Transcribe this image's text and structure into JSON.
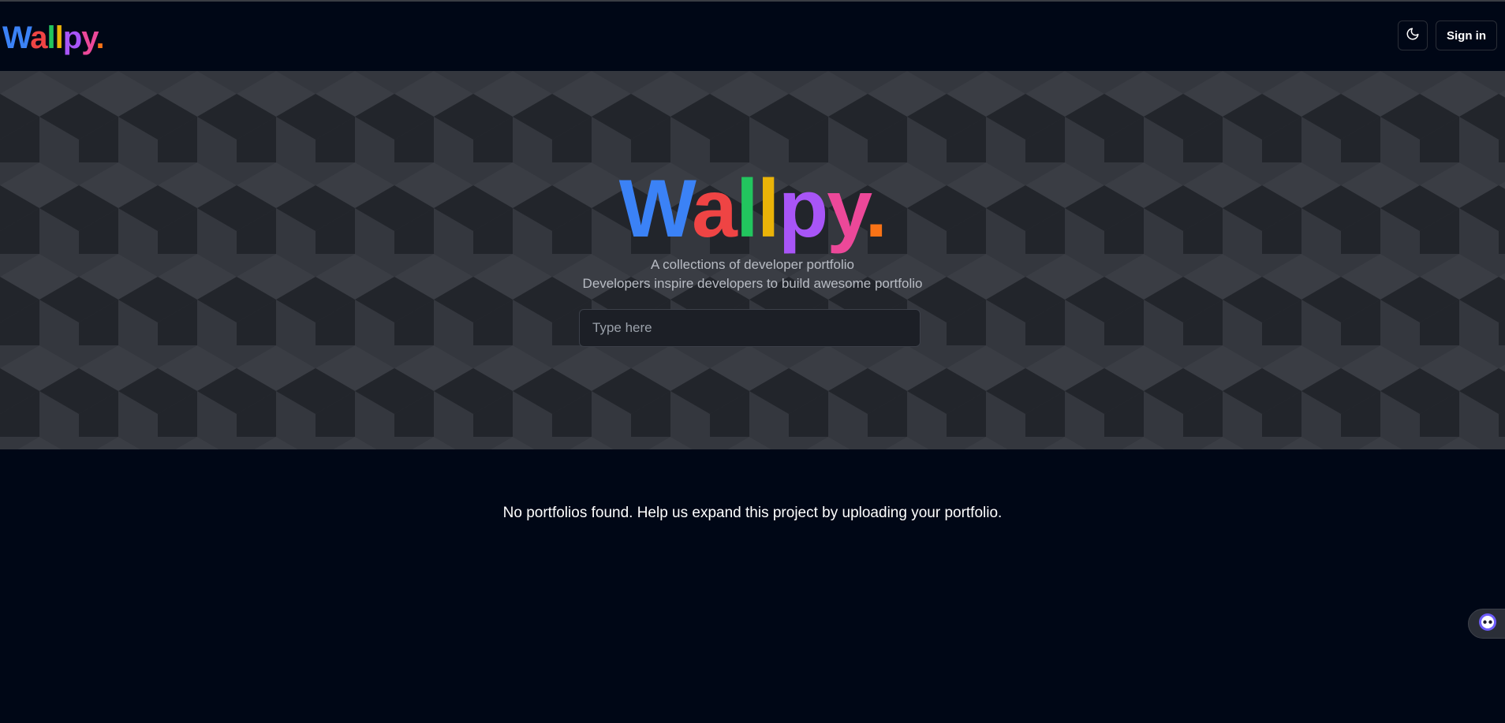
{
  "brand": {
    "letters": [
      "W",
      "a",
      "l",
      "l",
      "p",
      "y",
      "."
    ],
    "colors": [
      "#3b82f6",
      "#ef4444",
      "#22c55e",
      "#eab308",
      "#a855f7",
      "#ec4899",
      "#f97316"
    ]
  },
  "header": {
    "theme_icon": "moon-icon",
    "sign_in_label": "Sign in"
  },
  "hero": {
    "tagline_1": "A collections of developer portfolio",
    "tagline_2": "Developers inspire developers to build awesome portfolio",
    "search_placeholder": "Type here"
  },
  "main": {
    "empty_message": "No portfolios found. Help us expand this project by uploading your portfolio."
  },
  "widget": {
    "icon": "chatbot-icon"
  }
}
